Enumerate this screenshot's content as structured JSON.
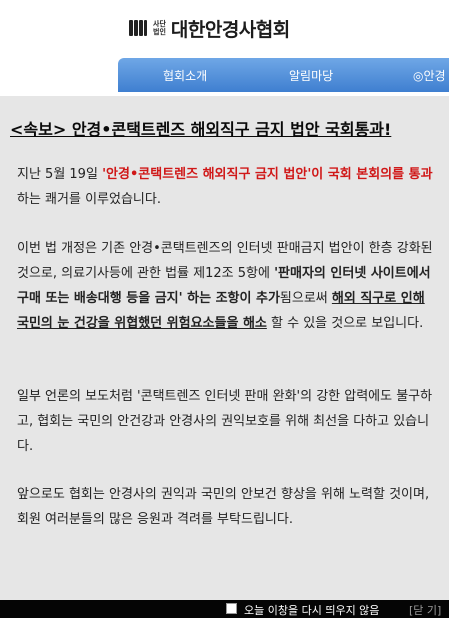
{
  "header": {
    "logo_small_line1": "사단",
    "logo_small_line2": "법인",
    "logo_text": "대한안경사협회"
  },
  "nav": {
    "items": [
      "협회소개",
      "알림마당",
      "◎안경"
    ]
  },
  "popup": {
    "headline": "<속보> 안경•콘택트렌즈 해외직구 금지 법안 국회통과!",
    "p1": {
      "t1": "지난 5월 19일 ",
      "t2": "'안경•콘택트렌즈 해외직구 금지 법안'이 국회 본회의를 통과",
      "t3": "하는 쾌거를 이루었습니다."
    },
    "p2": {
      "t1": "이번 법 개정은 기존 안경•콘택트렌즈의 인터넷 판매금지 법안이 한층 강화된 것으로, 의료기사등에 관한 법률 제12조 5항에 ",
      "t2": "'판매자의 인터넷 사이트에서 구매 또는 배송대행 등을 금지' 하는 조항이 추가",
      "t3": "됨으로써 ",
      "t4": "해외 직구로 인해 국민의 눈 건강을 위협했던 위험요소들을 해소",
      "t5": " 할 수 있을 것으로 보입니다."
    },
    "p3": "일부 언론의 보도처럼 '콘택트렌즈 인터넷 판매 완화'의 강한 압력에도 불구하고, 협회는 국민의 안건강과 안경사의 권익보호를 위해 최선을 다하고 있습니다.",
    "p4": "앞으로도 협회는 안경사의 권익과 국민의 안보건 향상을 위해 노력할 것이며, 회원 여러분들의 많은 응원과 격려를 부탁드립니다."
  },
  "footer": {
    "dont_show_label": "오늘 이창을 다시 띄우지 않음",
    "close_label": "[닫 기]"
  }
}
